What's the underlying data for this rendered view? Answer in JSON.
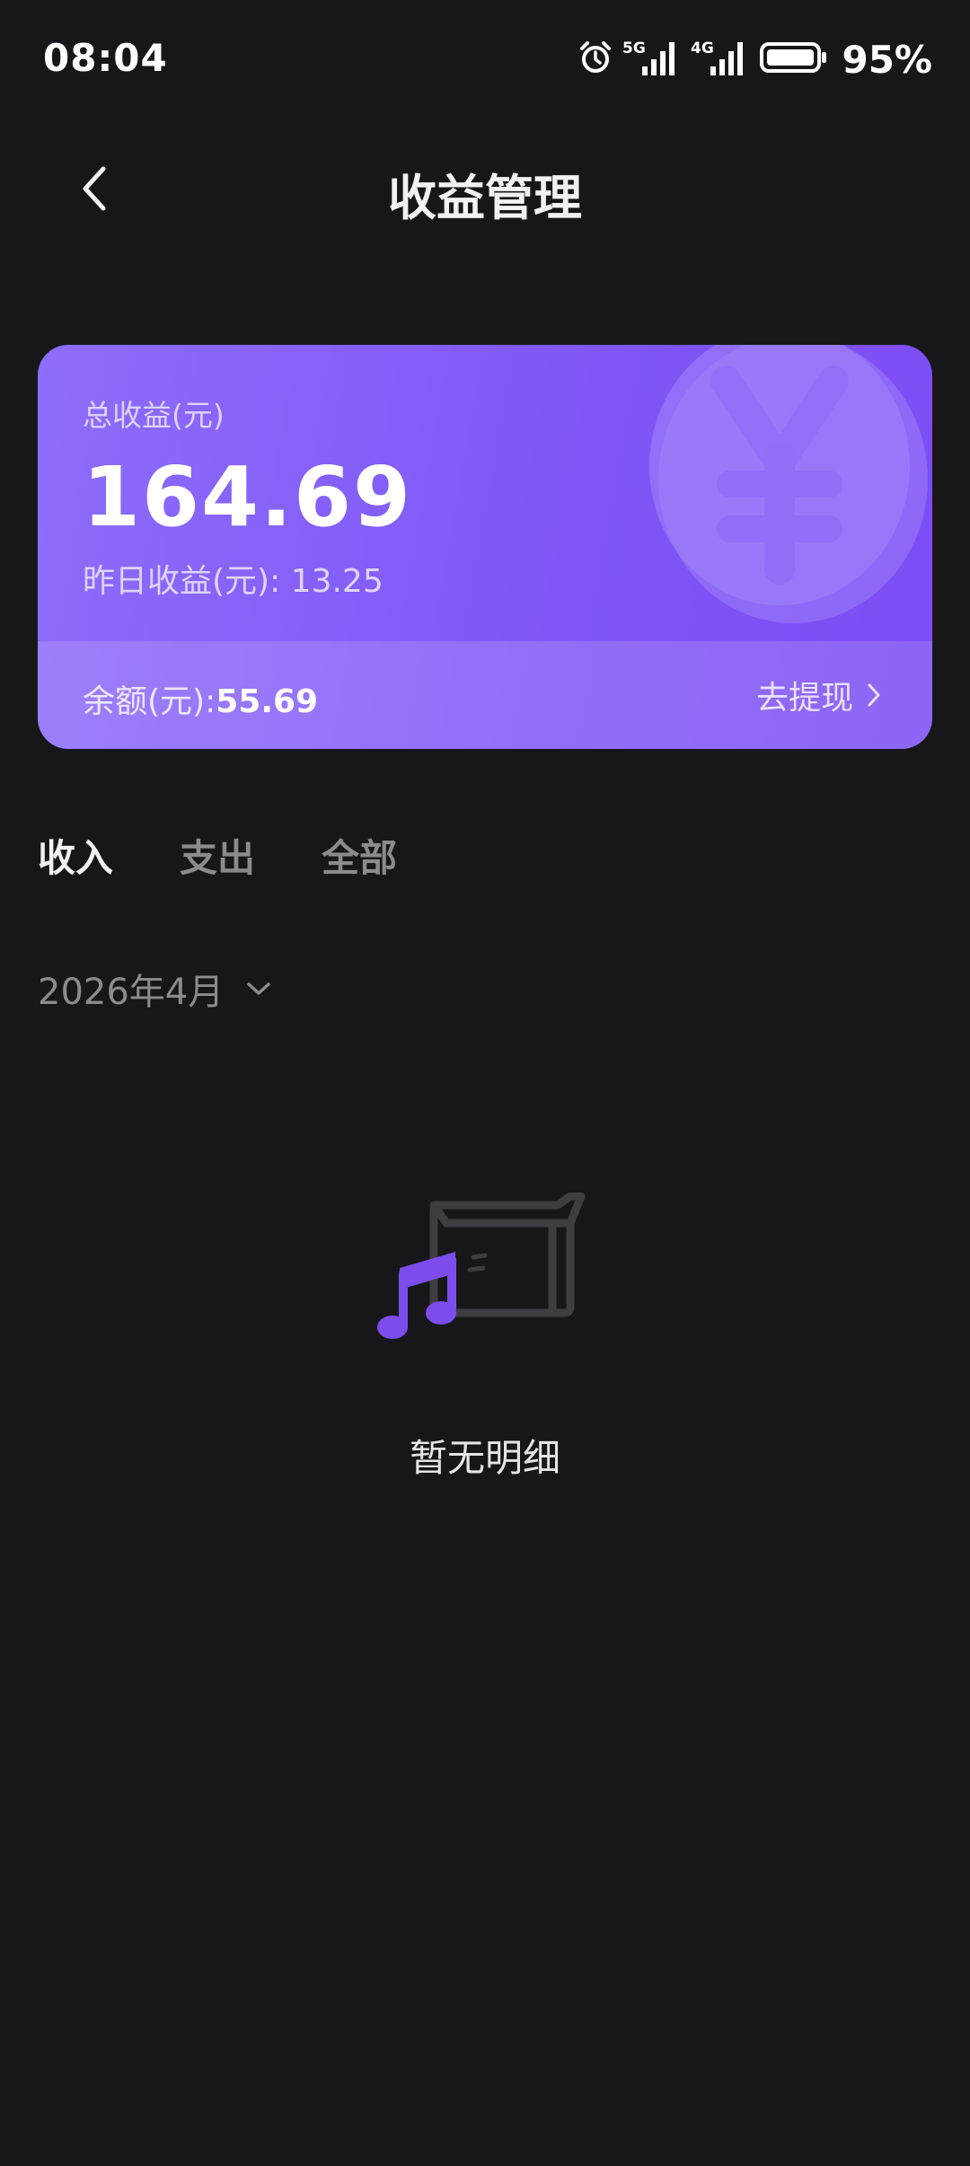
{
  "status_bar": {
    "time": "08:04",
    "network_1": "5G",
    "network_2": "4G",
    "battery_percent": "95%",
    "icons": [
      "alarm-icon",
      "signal-5g-icon",
      "signal-4g-icon",
      "battery-icon"
    ]
  },
  "header": {
    "title": "收益管理",
    "back_icon": "chevron-left-icon"
  },
  "earnings_card": {
    "total_label": "总收益(元)",
    "total_value": "164.69",
    "yesterday_label": "昨日收益(元): ",
    "yesterday_value": "13.25",
    "balance_label": "余额(元):",
    "balance_value": "55.69",
    "withdraw_label": "去提现",
    "colors": {
      "gradient_start": "#8d6dfb",
      "gradient_end": "#7c4cf4"
    }
  },
  "tabs": [
    {
      "label": "收入",
      "active": true
    },
    {
      "label": "支出",
      "active": false
    },
    {
      "label": "全部",
      "active": false
    }
  ],
  "month_selector": {
    "value": "2026年4月",
    "icon": "chevron-down-icon"
  },
  "empty_state": {
    "text": "暂无明细",
    "icon": "music-box-illustration"
  }
}
